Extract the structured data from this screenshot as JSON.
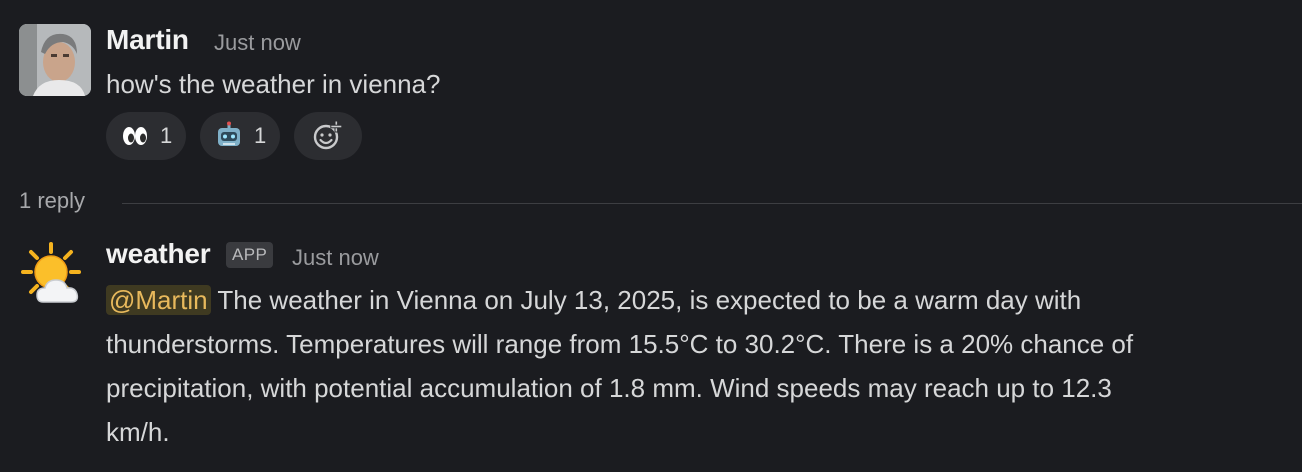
{
  "messages": [
    {
      "author": "Martin",
      "timestamp": "Just now",
      "text": "how's the weather in vienna?",
      "avatar": "photo-avatar",
      "reactions": [
        {
          "emoji": "eyes-emoji",
          "count": "1"
        },
        {
          "emoji": "robot-emoji",
          "count": "1"
        }
      ],
      "add_reaction_icon": "add-emoji-icon"
    }
  ],
  "thread": {
    "reply_count": "1 reply"
  },
  "reply": {
    "author": "weather",
    "badge": "APP",
    "timestamp": "Just now",
    "avatar": "sun-behind-cloud-emoji",
    "mention": "@Martin",
    "text_line1": "The weather in Vienna on July 13, 2025, is expected to be a warm day with",
    "text_line2": "thunderstorms. Temperatures will range from 15.5°C to 30.2°C. There is a 20% chance of",
    "text_line3": "precipitation, with potential accumulation of 1.8 mm. Wind speeds may reach up to 12.3",
    "text_line4": "km/h."
  },
  "colors": {
    "background": "#1b1c20",
    "mention_bg": "#3f3a21",
    "mention_fg": "#e8b95c"
  }
}
